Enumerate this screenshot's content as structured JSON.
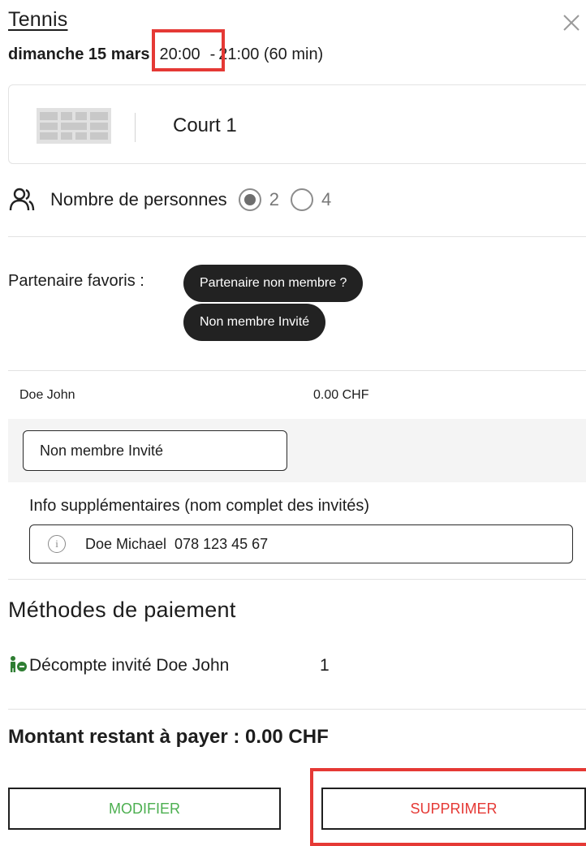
{
  "header": {
    "title": "Tennis",
    "date": "dimanche 15 mars",
    "time_start": "20:00",
    "separator": "-",
    "time_end": "21:00 (60 min)"
  },
  "court": {
    "label": "Court 1",
    "icon": "court-grid-icon"
  },
  "persons": {
    "label": "Nombre de personnes",
    "options": [
      {
        "value": "2",
        "selected": true
      },
      {
        "value": "4",
        "selected": false
      }
    ]
  },
  "partner": {
    "label": "Partenaire favoris :",
    "buttons": [
      "Partenaire non membre ?",
      "Non membre Invité"
    ]
  },
  "player": {
    "name": "Doe John",
    "price": "0.00 CHF",
    "type": "Non membre Invité"
  },
  "info": {
    "label": "Info supplémentaires (nom complet des invités)",
    "value": "Doe Michael  078 123 45 67"
  },
  "payment": {
    "title": "Méthodes de paiement",
    "item_label": "Décompte invité Doe John",
    "item_count": "1"
  },
  "remaining": "Montant restant à payer : 0.00 CHF",
  "actions": {
    "modify": "MODIFIER",
    "delete": "SUPPRIMER"
  },
  "colors": {
    "highlight": "#e53935",
    "modify": "#4caf50",
    "delete": "#e53935",
    "pill": "#222222",
    "payment_icon": "#2e7d32"
  }
}
